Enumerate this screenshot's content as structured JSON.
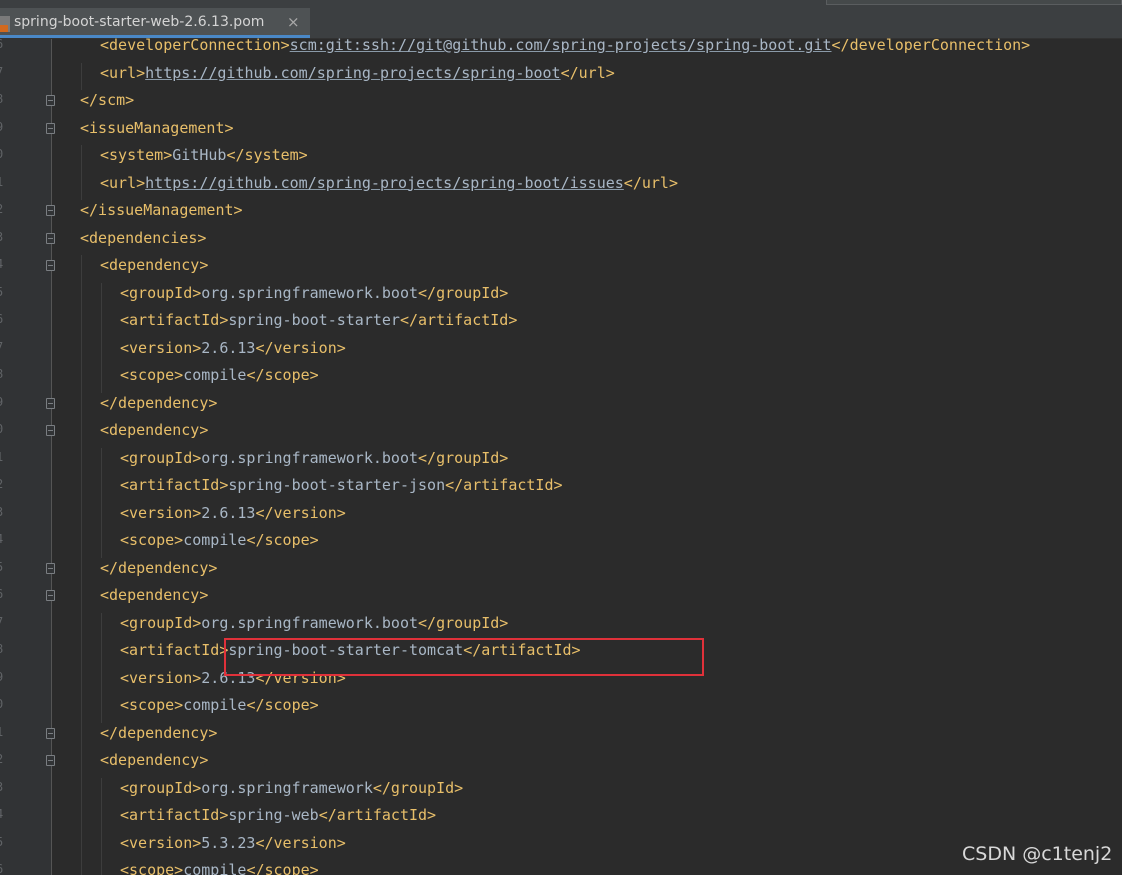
{
  "tab": {
    "label": "spring-boot-starter-web-2.6.13.pom",
    "close": "×"
  },
  "gutter": {
    "line_numbers": [
      "6",
      "7",
      "8",
      "9",
      "0",
      "1",
      "2",
      "3",
      "4",
      "5",
      "6",
      "7",
      "8",
      "9",
      "0",
      "1",
      "2",
      "3",
      "4",
      "5",
      "6",
      "7",
      "8",
      "9",
      "0",
      "1",
      "2",
      "3",
      "4",
      "5",
      "6"
    ]
  },
  "code": [
    {
      "indent": 1,
      "open": "developerConnection",
      "value": "scm:git:ssh://git@github.com/spring-projects/spring-boot.git",
      "close": "developerConnection",
      "link": true
    },
    {
      "indent": 1,
      "open": "url",
      "value": "https://github.com/spring-projects/spring-boot",
      "close": "url",
      "link": true
    },
    {
      "indent": 0,
      "raw": "</scm>"
    },
    {
      "indent": 0,
      "raw": "<issueManagement>"
    },
    {
      "indent": 1,
      "open": "system",
      "value": "GitHub",
      "close": "system"
    },
    {
      "indent": 1,
      "open": "url",
      "value": "https://github.com/spring-projects/spring-boot/issues",
      "close": "url",
      "link": true
    },
    {
      "indent": 0,
      "raw": "</issueManagement>"
    },
    {
      "indent": 0,
      "raw": "<dependencies>"
    },
    {
      "indent": 1,
      "raw": "<dependency>"
    },
    {
      "indent": 2,
      "open": "groupId",
      "value": "org.springframework.boot",
      "close": "groupId"
    },
    {
      "indent": 2,
      "open": "artifactId",
      "value": "spring-boot-starter",
      "close": "artifactId"
    },
    {
      "indent": 2,
      "open": "version",
      "value": "2.6.13",
      "close": "version"
    },
    {
      "indent": 2,
      "open": "scope",
      "value": "compile",
      "close": "scope"
    },
    {
      "indent": 1,
      "raw": "</dependency>"
    },
    {
      "indent": 1,
      "raw": "<dependency>"
    },
    {
      "indent": 2,
      "open": "groupId",
      "value": "org.springframework.boot",
      "close": "groupId"
    },
    {
      "indent": 2,
      "open": "artifactId",
      "value": "spring-boot-starter-json",
      "close": "artifactId"
    },
    {
      "indent": 2,
      "open": "version",
      "value": "2.6.13",
      "close": "version"
    },
    {
      "indent": 2,
      "open": "scope",
      "value": "compile",
      "close": "scope"
    },
    {
      "indent": 1,
      "raw": "</dependency>"
    },
    {
      "indent": 1,
      "raw": "<dependency>"
    },
    {
      "indent": 2,
      "open": "groupId",
      "value": "org.springframework.boot",
      "close": "groupId"
    },
    {
      "indent": 2,
      "open": "artifactId",
      "value": "spring-boot-starter-tomcat",
      "close": "artifactId"
    },
    {
      "indent": 2,
      "open": "version",
      "value": "2.6.13",
      "close": "version"
    },
    {
      "indent": 2,
      "open": "scope",
      "value": "compile",
      "close": "scope"
    },
    {
      "indent": 1,
      "raw": "</dependency>"
    },
    {
      "indent": 1,
      "raw": "<dependency>"
    },
    {
      "indent": 2,
      "open": "groupId",
      "value": "org.springframework",
      "close": "groupId"
    },
    {
      "indent": 2,
      "open": "artifactId",
      "value": "spring-web",
      "close": "artifactId"
    },
    {
      "indent": 2,
      "open": "version",
      "value": "5.3.23",
      "close": "version"
    },
    {
      "indent": 2,
      "open": "scope",
      "value": "compile",
      "close": "scope"
    }
  ],
  "watermark": "CSDN @c1tenj2",
  "colors": {
    "tag": "#e8bf6a",
    "text": "#a9b7c6",
    "background": "#2b2b2b",
    "highlight": "#e0313a"
  }
}
